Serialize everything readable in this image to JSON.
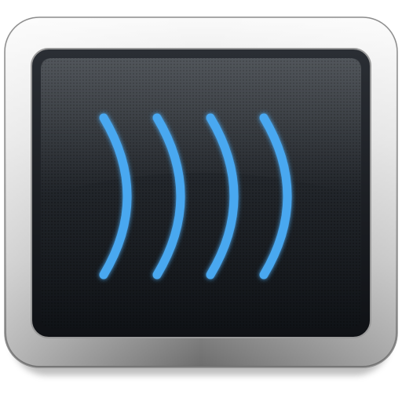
{
  "icon": {
    "name": "sound-waves-app-icon",
    "glyph": "sound-waves-icon",
    "colors": {
      "frame_light": "#f4f4f4",
      "frame_mid": "#c9c9c9",
      "frame_dark": "#6f6f6f",
      "bezel": "#1c1f24",
      "screen_top": "#2f3338",
      "screen_bottom": "#111418",
      "wave": "#4aa8f0",
      "wave_glow": "#2f8fe0"
    },
    "wave_count": 4
  }
}
